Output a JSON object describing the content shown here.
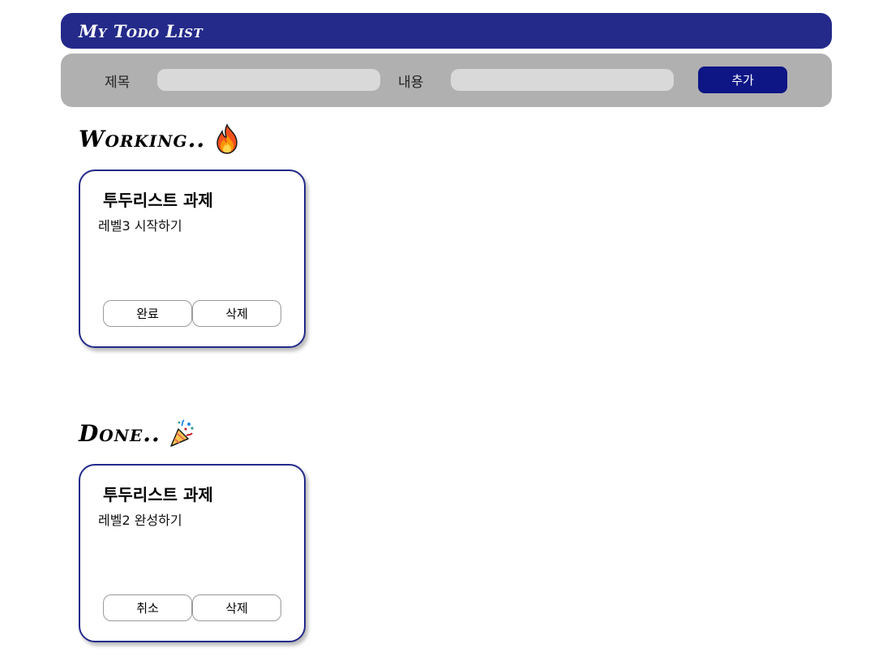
{
  "header": {
    "title": "My Todo List"
  },
  "form": {
    "title_label": "제목",
    "title_value": "",
    "content_label": "내용",
    "content_value": "",
    "add_label": "추가"
  },
  "working": {
    "heading": "Working..",
    "icon": "fire-icon",
    "cards": [
      {
        "title": "투두리스트 과제",
        "content": "레벨3 시작하기",
        "primary_label": "완료",
        "delete_label": "삭제"
      }
    ]
  },
  "done": {
    "heading": "Done..",
    "icon": "party-popper-icon",
    "cards": [
      {
        "title": "투두리스트 과제",
        "content": "레벨2 완성하기",
        "primary_label": "취소",
        "delete_label": "삭제"
      }
    ]
  },
  "colors": {
    "header_bg": "#242a8a",
    "form_bg": "#b0b0b0",
    "input_bg": "#d9d9d9",
    "add_button_bg": "#0e1585",
    "card_border": "#242a8a"
  }
}
